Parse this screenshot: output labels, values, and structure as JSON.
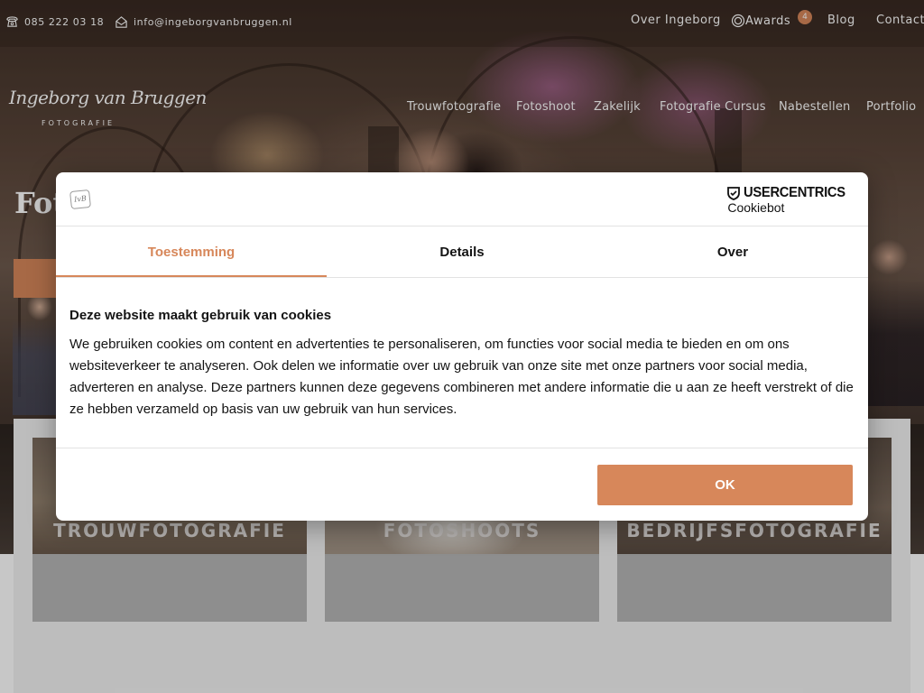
{
  "topbar": {
    "phone": "085 222 03 18",
    "email": "info@ingeborgvanbruggen.nl",
    "links": {
      "over": "Over Ingeborg",
      "awards": "Awards",
      "blog": "Blog",
      "contact": "Contact"
    },
    "awards_count": "4"
  },
  "logo": {
    "name": "Ingeborg van Bruggen",
    "tagline": "FOTOGRAFIE"
  },
  "mainnav": [
    "Trouwfotografie",
    "Fotoshoot",
    "Zakelijk",
    "Fotografie Cursus",
    "Nabestellen",
    "Portfolio"
  ],
  "hero": {
    "title_partial": "Fot"
  },
  "cards": [
    "TROUWFOTOGRAFIE",
    "FOTOSHOOTS",
    "BEDRIJFSFOTOGRAFIE"
  ],
  "cookie": {
    "brand": "USERCENTRICS",
    "product": "Cookiebot",
    "tabs": [
      "Toestemming",
      "Details",
      "Over"
    ],
    "active_tab": "Toestemming",
    "heading": "Deze website maakt gebruik van cookies",
    "text": "We gebruiken cookies om content en advertenties te personaliseren, om functies voor social media te bieden en om ons websiteverkeer te analyseren. Ook delen we informatie over uw gebruik van onze site met onze partners voor social media, adverteren en analyse. Deze partners kunnen deze gegevens combineren met andere informatie die u aan ze heeft verstrekt of die ze hebben verzameld op basis van uw gebruik van hun services.",
    "ok_label": "OK"
  },
  "colors": {
    "accent": "#d7875a",
    "text": "#141414"
  },
  "icons": {
    "phone": "phone-icon",
    "email": "mail-icon",
    "awards": "award-icon",
    "usercentrics": "shield-check-icon"
  }
}
